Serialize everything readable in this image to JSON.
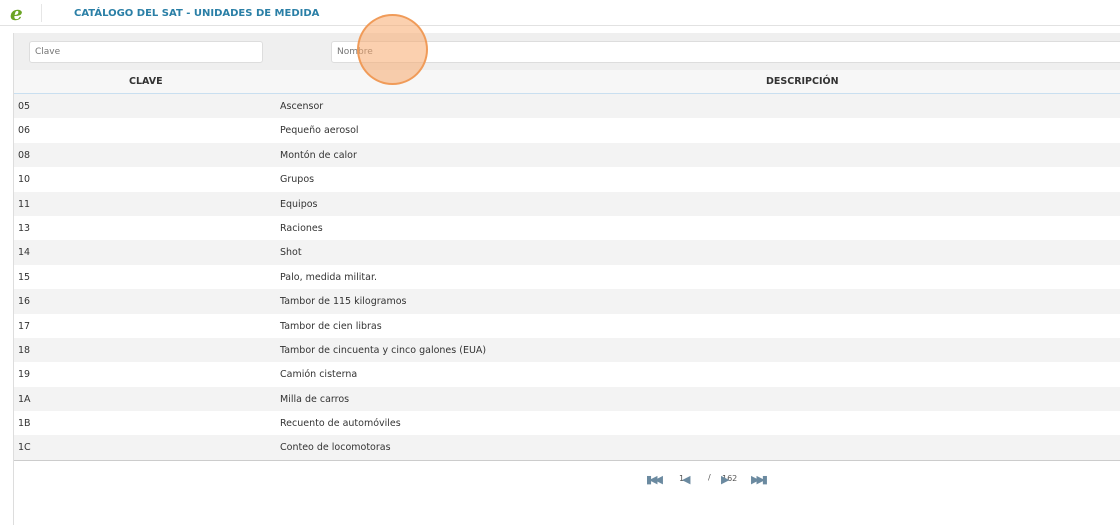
{
  "header": {
    "logo": "e",
    "title": "CATÁLOGO DEL SAT - UNIDADES DE MEDIDA"
  },
  "filters": {
    "clave_placeholder": "Clave",
    "nombre_placeholder": "Nombre"
  },
  "table": {
    "columns": [
      "CLAVE",
      "DESCRIPCIÓN"
    ],
    "rows": [
      [
        "05",
        "Ascensor"
      ],
      [
        "06",
        "Pequeño aerosol"
      ],
      [
        "08",
        "Montón de calor"
      ],
      [
        "10",
        "Grupos"
      ],
      [
        "11",
        "Equipos"
      ],
      [
        "13",
        "Raciones"
      ],
      [
        "14",
        "Shot"
      ],
      [
        "15",
        "Palo, medida militar."
      ],
      [
        "16",
        "Tambor de 115 kilogramos"
      ],
      [
        "17",
        "Tambor de cien libras"
      ],
      [
        "18",
        "Tambor de cincuenta y cinco galones (EUA)"
      ],
      [
        "19",
        "Camión cisterna"
      ],
      [
        "1A",
        "Milla de carros"
      ],
      [
        "1B",
        "Recuento de automóviles"
      ],
      [
        "1C",
        "Conteo de locomotoras"
      ]
    ]
  },
  "pagination": {
    "current": "1",
    "separator": "/",
    "total": "162",
    "first": "⏮",
    "prev": "◀",
    "next": "▶",
    "last": "⏭"
  }
}
